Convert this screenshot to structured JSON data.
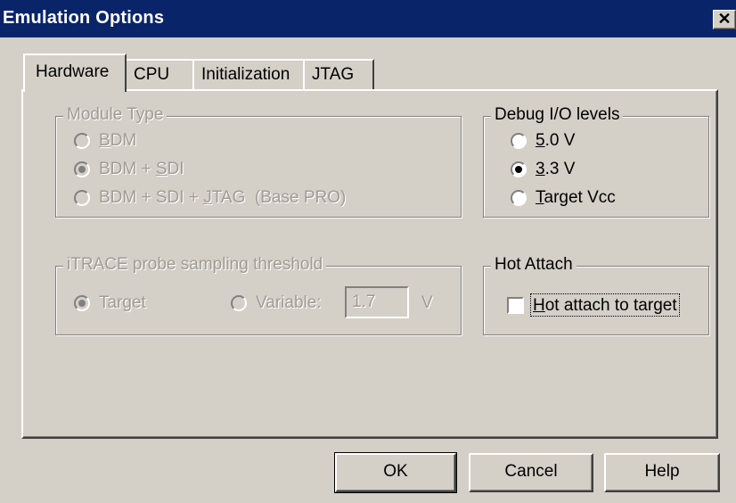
{
  "window": {
    "title": "Emulation Options",
    "close_glyph": "✕"
  },
  "tabs": [
    {
      "label": "Hardware",
      "active": true
    },
    {
      "label": "CPU",
      "active": false
    },
    {
      "label": "Initialization",
      "active": false
    },
    {
      "label": "JTAG",
      "active": false
    }
  ],
  "module_type": {
    "legend": "Module Type",
    "enabled": false,
    "options": [
      {
        "before": "",
        "mnemonic": "B",
        "after": "DM",
        "selected": false
      },
      {
        "before": "BDM + ",
        "mnemonic": "S",
        "after": "DI",
        "selected": true
      },
      {
        "before": "BDM + SDI + ",
        "mnemonic": "J",
        "after": "TAG  (Base PRO)",
        "selected": false
      }
    ]
  },
  "debug_io": {
    "legend": "Debug I/O levels",
    "options": [
      {
        "before": "",
        "mnemonic": "5",
        "after": ".0 V",
        "selected": false
      },
      {
        "before": "",
        "mnemonic": "3",
        "after": ".3 V",
        "selected": true
      },
      {
        "before": "",
        "mnemonic": "T",
        "after": "arget Vcc",
        "selected": false
      }
    ]
  },
  "itrace": {
    "legend": "iTRACE probe sampling threshold",
    "enabled": false,
    "target_label": "Target",
    "target_selected": true,
    "variable_label": "Variable:",
    "variable_selected": false,
    "variable_value": "1.7",
    "unit": "V"
  },
  "hot_attach": {
    "legend": "Hot Attach",
    "checkbox": {
      "mnemonic": "H",
      "after": "ot attach to target",
      "checked": false
    }
  },
  "buttons": {
    "ok": "OK",
    "cancel": "Cancel",
    "help": "Help"
  },
  "colors": {
    "titlebar": "#0a246a",
    "face": "#d4d0c8",
    "disabled_text": "#a09c94"
  }
}
